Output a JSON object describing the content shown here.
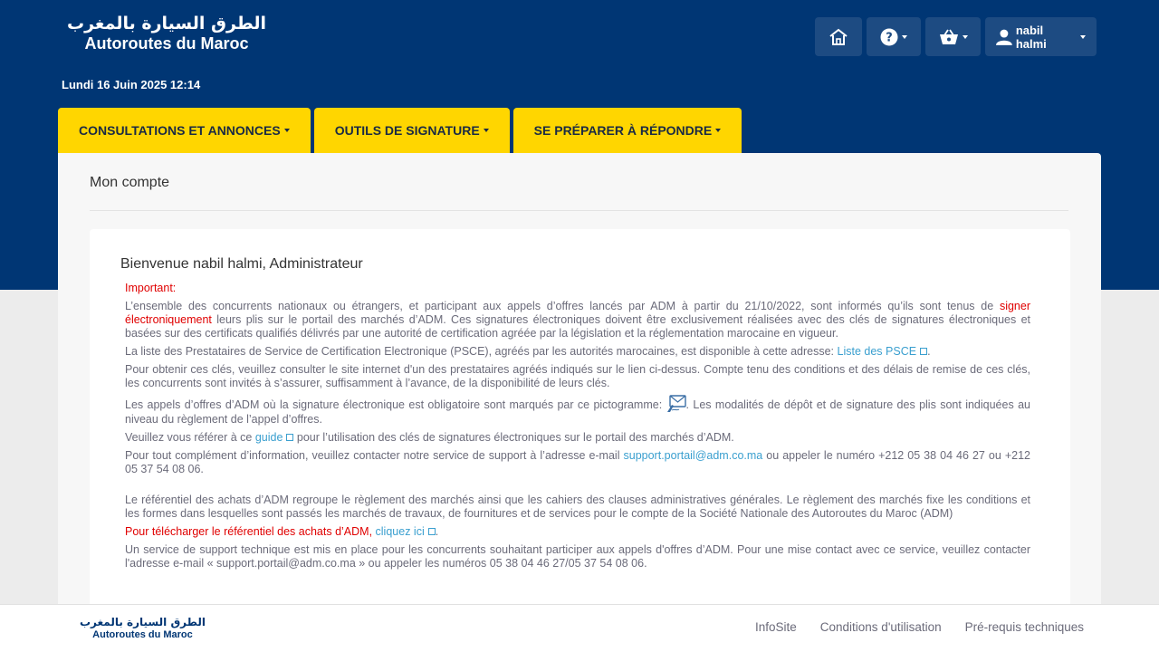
{
  "header": {
    "logo_ar": "الطرق السيارة بالمغرب",
    "logo_fr": "Autoroutes du Maroc",
    "date": "Lundi 16 Juin 2025 12:14",
    "user_name": "nabil halmi",
    "icons": [
      "home-icon",
      "help-icon",
      "basket-icon",
      "user-icon"
    ]
  },
  "menu": {
    "tabs": [
      {
        "label": "CONSULTATIONS ET ANNONCES"
      },
      {
        "label": "OUTILS DE SIGNATURE"
      },
      {
        "label": "SE PRÉPARER À RÉPONDRE"
      }
    ]
  },
  "page": {
    "title": "Mon compte",
    "welcome": "Bienvenue nabil halmi, Administrateur",
    "important": "Important:",
    "p1_a": "L’ensemble des concurrents nationaux ou étrangers, et participant aux appels d’offres lancés par ADM à partir du 21/10/2022, sont informés qu’ils sont tenus de ",
    "p1_red": "signer électroniquement",
    "p1_b": " leurs plis sur le portail des marchés d’ADM. Ces signatures électroniques doivent être exclusivement réalisées avec des clés de signatures électroniques et basées sur des certificats qualifiés délivrés par une autorité de certification agréée par la législation et la réglementation marocaine en vigueur.",
    "p2_a": "La liste des Prestataires de Service de Certification Electronique (PSCE), agréés par les autorités marocaines, est disponible à cette adresse: ",
    "p2_link": "Liste des PSCE",
    "p2_b": ".",
    "p3": "Pour obtenir ces clés, veuillez consulter le site internet d'un des prestataires agréés indiqués sur le lien ci-dessus. Compte tenu des conditions et des délais de remise de ces clés, les concurrents sont invités à s’assurer, suffisamment à l’avance, de la disponibilité de leurs clés.",
    "p4_a": "Les appels d’offres d’ADM où la signature électronique est obligatoire sont marqués par ce pictogramme: ",
    "p4_b": ". Les modalités de dépôt et de signature des plis sont indiquées au niveau du règlement de l’appel d’offres.",
    "p5_a": "Veuillez vous référer à ce ",
    "p5_link": "guide",
    "p5_b": " pour l’utilisation des clés de signatures électroniques sur le portail des marchés d’ADM.",
    "p6_a": "Pour tout complément d’information, veuillez contacter notre service de support à l’adresse e-mail ",
    "p6_link": "support.portail@adm.co.ma",
    "p6_b": " ou appeler le numéro +212 05 38 04 46 27 ou +212 05 37 54 08 06.",
    "p7": "Le référentiel des achats d’ADM regroupe le règlement des marchés ainsi que les cahiers des clauses administratives générales. Le règlement des marchés fixe les conditions et les formes dans lesquelles sont passés les marchés de travaux, de fournitures et de services pour le compte de la Société Nationale des Autoroutes du Maroc (ADM)",
    "p8_red": "Pour télécharger le référentiel des achats d’ADM, ",
    "p8_link": "cliquez ici",
    "p8_b": ".",
    "p9": "Un service de support technique est mis en place pour les concurrents souhaitant participer aux appels d'offres d’ADM. Pour une mise contact avec ce service, veuillez contacter l'adresse e-mail « support.portail@adm.co.ma » ou appeler les numéros 05 38 04 46 27/05 37 54 08 06."
  },
  "footer": {
    "logo_ar": "الطرق السيارة بالمغرب",
    "logo_fr": "Autoroutes du Maroc",
    "links": [
      "InfoSite",
      "Conditions d'utilisation",
      "Pré-requis techniques"
    ]
  },
  "colors": {
    "header_bg": "#003674",
    "menu_bg": "#ffd600",
    "link": "#3a9fcf",
    "alert": "#e00000"
  }
}
